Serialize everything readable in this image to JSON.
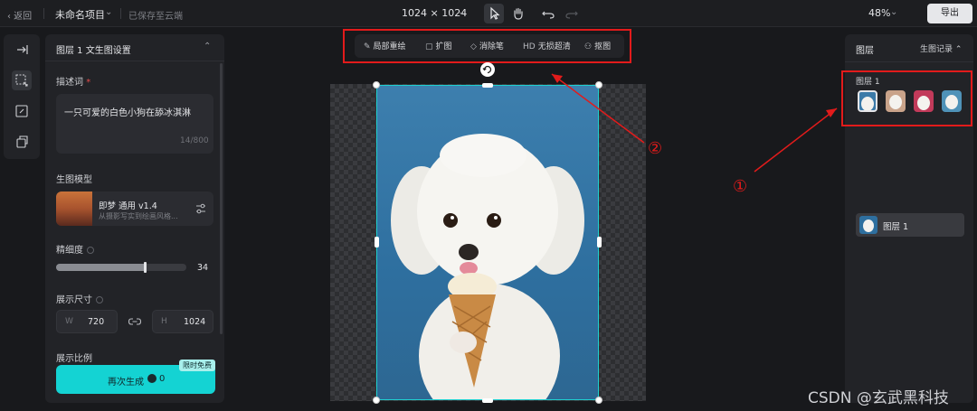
{
  "topbar": {
    "back_label": "‹ 返回",
    "project_name": "未命名项目",
    "save_status": "已保存至云端",
    "canvas_size": "1024 × 1024",
    "zoom": "48%",
    "export_label": "导出"
  },
  "left_panel": {
    "title": "图层 1 文生图设置",
    "prompt_label": "描述词",
    "prompt_required_mark": "*",
    "prompt_text": "一只可爱的白色小狗在舔冰淇淋",
    "prompt_count": "14/800",
    "model_section_label": "生图模型",
    "model_name": "即梦 通用 v1.4",
    "model_desc": "从摄影写实到绘画风格...",
    "detail_label": "精细度",
    "detail_value": 34,
    "size_label": "展示尺寸",
    "width_key": "W",
    "width_value": "720",
    "height_key": "H",
    "height_value": "1024",
    "ratio_label": "展示比例",
    "generate_label": "再次生成",
    "generate_cost": "0",
    "free_badge": "限时免费"
  },
  "float_toolbar": {
    "items": [
      {
        "icon": "brush-icon",
        "label": "局部重绘"
      },
      {
        "icon": "expand-icon",
        "label": "扩图"
      },
      {
        "icon": "eraser-icon",
        "label": "消除笔"
      },
      {
        "icon": "hd-icon",
        "icon_text": "HD",
        "label": "无损超清"
      },
      {
        "icon": "cutout-icon",
        "label": "抠图"
      }
    ]
  },
  "annotations": {
    "marker_1": "①",
    "marker_2": "②",
    "color": "#e21b1b"
  },
  "right_panel": {
    "title": "图层",
    "history_label": "生图记录 ⌃",
    "history_group_label": "图层 1",
    "layer_row_label": "图层 1"
  },
  "watermark": "CSDN @玄武黑科技",
  "colors": {
    "accent": "#14d3d3",
    "selection": "#1fd0d0",
    "background": "#18191c"
  }
}
